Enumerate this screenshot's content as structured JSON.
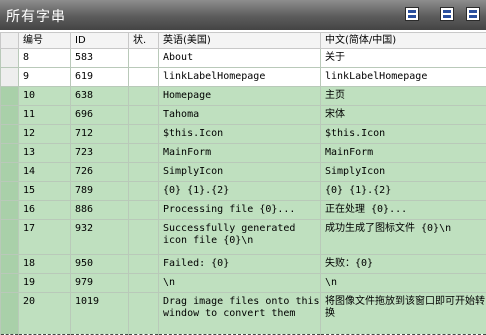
{
  "window": {
    "title": "所有字串"
  },
  "toolbar": {
    "buttons": [
      "grid-view",
      "import",
      "export"
    ]
  },
  "columns": [
    "编号",
    "ID",
    "状.",
    "英语(美国)",
    "中文(简体/中国)"
  ],
  "rows": [
    {
      "no": "8",
      "id": "583",
      "status": "",
      "english": "About",
      "chinese": "关于"
    },
    {
      "no": "9",
      "id": "619",
      "status": "",
      "english": "linkLabelHomepage",
      "chinese": "linkLabelHomepage"
    },
    {
      "no": "10",
      "id": "638",
      "status": "",
      "english": "Homepage",
      "chinese": "主页"
    },
    {
      "no": "11",
      "id": "696",
      "status": "",
      "english": "Tahoma",
      "chinese": "宋体"
    },
    {
      "no": "12",
      "id": "712",
      "status": "",
      "english": "$this.Icon",
      "chinese": "$this.Icon"
    },
    {
      "no": "13",
      "id": "723",
      "status": "",
      "english": "MainForm",
      "chinese": "MainForm"
    },
    {
      "no": "14",
      "id": "726",
      "status": "",
      "english": "SimplyIcon",
      "chinese": "SimplyIcon"
    },
    {
      "no": "15",
      "id": "789",
      "status": "",
      "english": "{0} {1}.{2}",
      "chinese": "{0} {1}.{2}"
    },
    {
      "no": "16",
      "id": "886",
      "status": "",
      "english": "Processing file {0}...",
      "chinese": "正在处理 {0}..."
    },
    {
      "no": "17",
      "id": "932",
      "status": "",
      "english": "Successfully generated icon file {0}\\n",
      "chinese": "成功生成了图标文件 {0}\\n"
    },
    {
      "no": "18",
      "id": "950",
      "status": "",
      "english": "Failed: {0}",
      "chinese": "失败：{0}"
    },
    {
      "no": "19",
      "id": "979",
      "status": "",
      "english": "\\n",
      "chinese": "\\n"
    },
    {
      "no": "20",
      "id": "1019",
      "status": "",
      "english": "Drag image files onto this window to convert them",
      "chinese": "将图像文件拖放到该窗口即可开始转换"
    }
  ],
  "colors": {
    "title_bar": "#5c5c5c",
    "row_green": "#bfe0bf",
    "row_white": "#ffffff",
    "grid_line": "#b9c9b9"
  }
}
